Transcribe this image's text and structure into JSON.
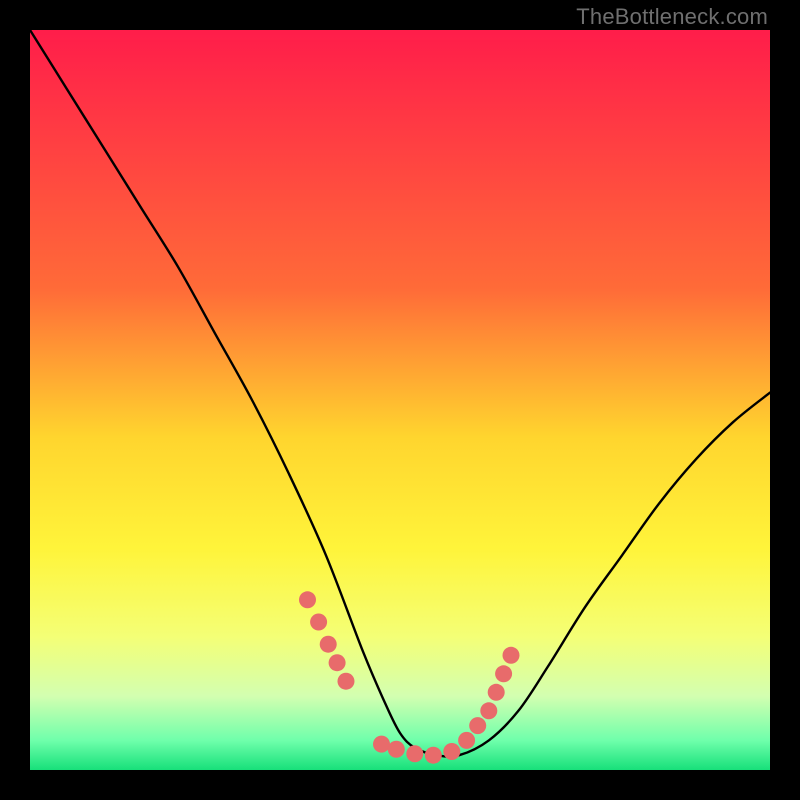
{
  "watermark": "TheBottleneck.com",
  "chart_data": {
    "type": "line",
    "title": "",
    "xlabel": "",
    "ylabel": "",
    "xlim": [
      0,
      100
    ],
    "ylim": [
      0,
      100
    ],
    "gradient_stops": [
      {
        "offset": 0,
        "color": "#ff1d4a"
      },
      {
        "offset": 35,
        "color": "#ff6b38"
      },
      {
        "offset": 55,
        "color": "#ffd52e"
      },
      {
        "offset": 70,
        "color": "#fff43a"
      },
      {
        "offset": 82,
        "color": "#f4ff76"
      },
      {
        "offset": 90,
        "color": "#d3ffb0"
      },
      {
        "offset": 96,
        "color": "#6fffab"
      },
      {
        "offset": 100,
        "color": "#17e07a"
      }
    ],
    "series": [
      {
        "name": "bottleneck-curve",
        "x": [
          0,
          5,
          10,
          15,
          20,
          25,
          30,
          35,
          40,
          45,
          48,
          50,
          52,
          55,
          58,
          62,
          66,
          70,
          75,
          80,
          85,
          90,
          95,
          100
        ],
        "y": [
          100,
          92,
          84,
          76,
          68,
          59,
          50,
          40,
          29,
          16,
          9,
          5,
          3,
          2,
          2,
          4,
          8,
          14,
          22,
          29,
          36,
          42,
          47,
          51
        ]
      }
    ],
    "markers": {
      "name": "highlight-dots",
      "color": "#e86b6b",
      "x": [
        37.5,
        39.0,
        40.3,
        41.5,
        42.7,
        47.5,
        49.5,
        52.0,
        54.5,
        57.0,
        59.0,
        60.5,
        62.0,
        63.0,
        64.0,
        65.0
      ],
      "y": [
        23.0,
        20.0,
        17.0,
        14.5,
        12.0,
        3.5,
        2.8,
        2.2,
        2.0,
        2.5,
        4.0,
        6.0,
        8.0,
        10.5,
        13.0,
        15.5
      ]
    }
  }
}
